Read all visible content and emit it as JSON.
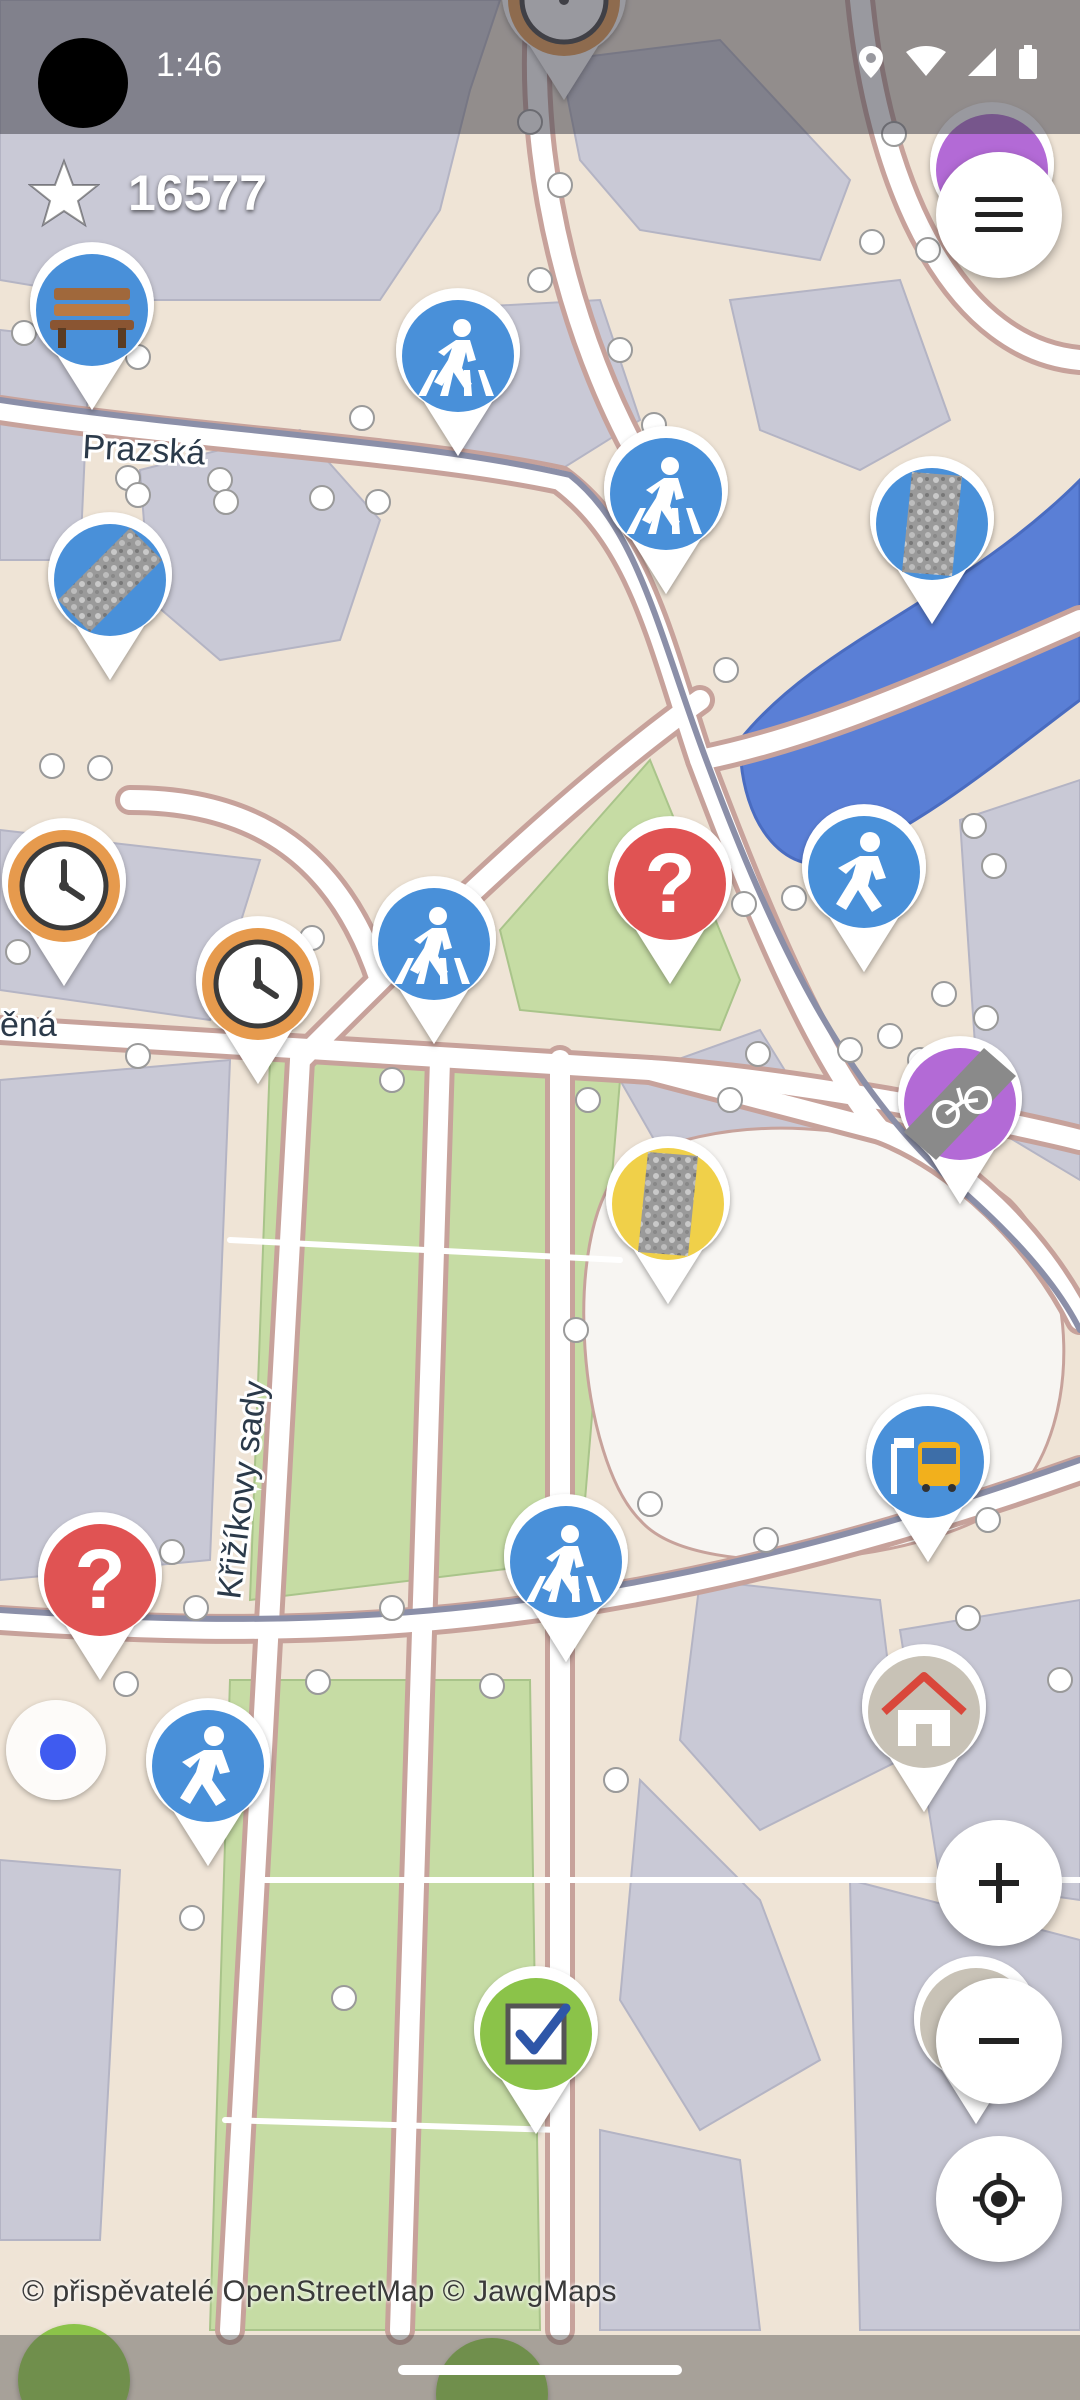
{
  "status_bar": {
    "time": "1:46",
    "icons": [
      "location-icon",
      "wifi-icon",
      "cell-signal-icon",
      "battery-icon"
    ]
  },
  "score": {
    "icon": "star-icon",
    "value": "16577"
  },
  "map": {
    "street_labels": {
      "prazska": "Prazská",
      "krizikovy": "Křižíkovy sady",
      "cut": "ěná"
    },
    "colors": {
      "background": "#efe4d6",
      "building": "#c9c9d6",
      "park": "#c6dca4",
      "water": "#5a7fd6",
      "road": "#ffffff",
      "road_casing": "#c7a29b"
    }
  },
  "markers": [
    {
      "name": "bench-quest-marker",
      "icon": "bench-icon",
      "color": "#4a90d9"
    },
    {
      "name": "crossing-quest-marker",
      "icon": "pedestrian-crossing-icon",
      "color": "#4a90d9"
    },
    {
      "name": "surface-quest-marker",
      "icon": "surface-gravel-icon",
      "color": "#4a90d9"
    },
    {
      "name": "opening-hours-quest-marker",
      "icon": "clock-icon",
      "color": "#e69a4e"
    },
    {
      "name": "note-quest-marker",
      "icon": "question-icon",
      "color": "#e05353"
    },
    {
      "name": "sidewalk-quest-marker",
      "icon": "pedestrian-icon",
      "color": "#4a90d9"
    },
    {
      "name": "cycleway-quest-marker",
      "icon": "bicycle-icon",
      "color": "#b36bd6"
    },
    {
      "name": "surface-yellow-quest-marker",
      "icon": "surface-gravel-icon",
      "color": "#f0d04a"
    },
    {
      "name": "bus-stop-quest-marker",
      "icon": "bus-stop-icon",
      "color": "#4a90d9"
    },
    {
      "name": "building-quest-marker",
      "icon": "house-icon",
      "color": "#c8c2b6"
    },
    {
      "name": "checkbox-quest-marker",
      "icon": "checkbox-icon",
      "color": "#8bc34a"
    }
  ],
  "controls": {
    "menu": "menu-icon",
    "zoom_in": "plus-icon",
    "zoom_out": "minus-icon",
    "locate": "gps-crosshair-icon"
  },
  "attribution": "© přispěvatelé OpenStreetMap  © JawgMaps"
}
